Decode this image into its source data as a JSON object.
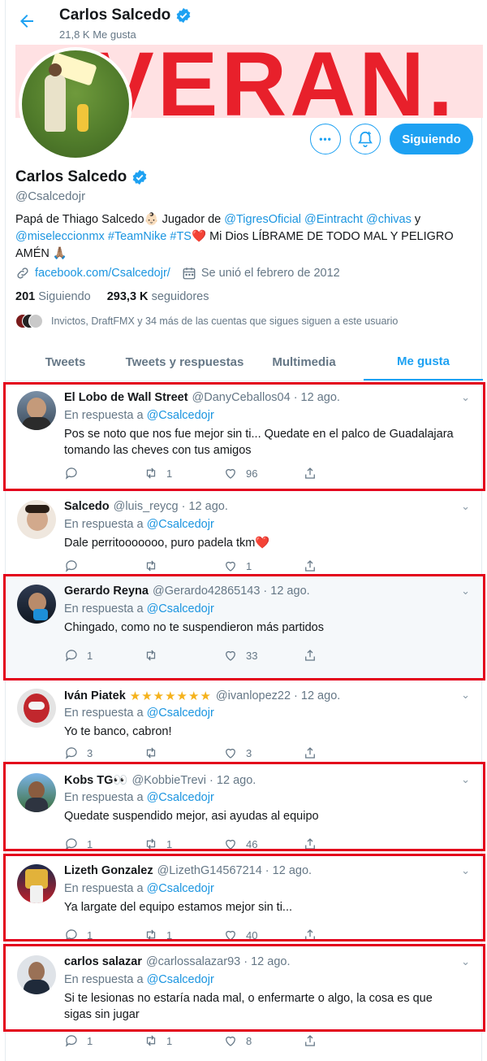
{
  "header": {
    "back_label": "←",
    "name": "Carlos Salcedo",
    "likes": "21,8 K Me gusta"
  },
  "banner": {
    "text": "VERAN."
  },
  "profile": {
    "name": "Carlos Salcedo",
    "handle": "@Csalcedojr",
    "bio_prefix": "Papá de Thiago Salcedo",
    "bio_baby": "👶🏻",
    "bio_mid": " Jugador de ",
    "bio_links_1": "@TigresOficial @Eintracht @chivas",
    "bio_and": " y ",
    "bio_links_2": "@miseleccionmx #TeamNike #TS",
    "bio_heart": "❤️",
    "bio_suffix": " Mi Dios LÍBRAME DE TODO MAL Y PELIGRO AMÉN ",
    "bio_pray": "🙏🏽",
    "website": "facebook.com/Csalcedojr/",
    "joined": "Se unió el febrero de 2012",
    "following_count": "201",
    "following_label": "Siguiendo",
    "followers_count": "293,3 K",
    "followers_label": "seguidores",
    "mutual_text": "Invictos, DraftFMX y 34 más de las cuentas que sigues siguen a este usuario"
  },
  "buttons": {
    "more": "•••",
    "follow": "Siguiendo"
  },
  "tabs": [
    {
      "label": "Tweets"
    },
    {
      "label": "Tweets y respuestas"
    },
    {
      "label": "Multimedia"
    },
    {
      "label": "Me gusta"
    }
  ],
  "tweets": [
    {
      "name": "El Lobo de Wall Street",
      "handle": "@DanyCeballos04 · 12 ago.",
      "reply_prefix": "En respuesta a",
      "reply_to": "@Csalcedojr",
      "text": "Pos se noto que nos fue mejor sin ti... Quedate en el palco de Guadalajara tomando las cheves con tus amigos",
      "replies": "",
      "retweets": "1",
      "likes": "96"
    },
    {
      "name": "Salcedo",
      "handle": "@luis_reycg · 12 ago.",
      "reply_prefix": "En respuesta a",
      "reply_to": "@Csalcedojr",
      "text": "Dale perritooooooo, puro padela tkm❤️",
      "replies": "",
      "retweets": "",
      "likes": "1"
    },
    {
      "name": "Gerardo Reyna",
      "handle": "@Gerardo42865143 · 12 ago.",
      "reply_prefix": "En respuesta a",
      "reply_to": "@Csalcedojr",
      "text": "Chingado, como no te suspendieron más partidos",
      "replies": "1",
      "retweets": "",
      "likes": "33"
    },
    {
      "name": "Iván Piatek",
      "stars": "★★★★★★★",
      "handle": "@ivanlopez22 · 12 ago.",
      "reply_prefix": "En respuesta a",
      "reply_to": "@Csalcedojr",
      "text": "Yo te banco, cabron!",
      "replies": "3",
      "retweets": "",
      "likes": "3"
    },
    {
      "name": "Kobs TG👀",
      "handle": "@KobbieTrevi · 12 ago.",
      "reply_prefix": "En respuesta a",
      "reply_to": "@Csalcedojr",
      "text": "Quedate suspendido mejor, asi ayudas al equipo",
      "replies": "1",
      "retweets": "1",
      "likes": "46"
    },
    {
      "name": "Lizeth Gonzalez",
      "handle": "@LizethG14567214 · 12 ago.",
      "reply_prefix": "En respuesta a",
      "reply_to": "@Csalcedojr",
      "text": "Ya largate del equipo estamos mejor sin ti...",
      "replies": "1",
      "retweets": "1",
      "likes": "40"
    },
    {
      "name": "carlos salazar",
      "handle": "@carlossalazar93 · 12 ago.",
      "reply_prefix": "En respuesta a",
      "reply_to": "@Csalcedojr",
      "text": "Si te lesionas no estaría nada mal, o enfermarte o algo, la cosa es que sigas sin jugar",
      "replies": "1",
      "retweets": "1",
      "likes": "8"
    }
  ],
  "colors": {
    "accent": "#1da1f2",
    "highlight": "#e3001b"
  }
}
